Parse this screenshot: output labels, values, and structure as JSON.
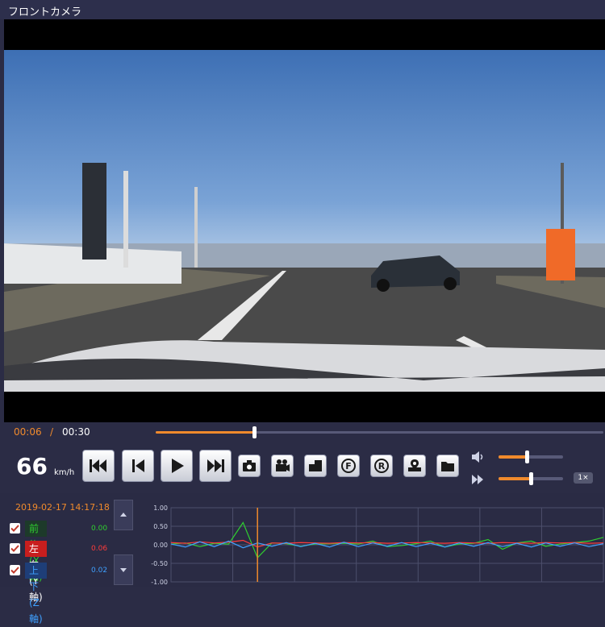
{
  "window": {
    "title": "フロントカメラ"
  },
  "player": {
    "current_time": "00:06",
    "separator": "/",
    "total_time": "00:30",
    "progress": 0.22
  },
  "speedometer": {
    "value": "66",
    "unit": "km/h"
  },
  "toolbar": {
    "buttons": [
      {
        "name": "skip-to-start-button",
        "icon": "skip-start-icon"
      },
      {
        "name": "previous-frame-button",
        "icon": "step-back-icon"
      },
      {
        "name": "play-button",
        "icon": "play-icon"
      },
      {
        "name": "skip-to-end-button",
        "icon": "skip-end-icon"
      },
      {
        "name": "snapshot-button",
        "icon": "camera-icon"
      },
      {
        "name": "video-clip-button",
        "icon": "video-camera-icon"
      },
      {
        "name": "open-file-button",
        "icon": "open-folder-icon"
      },
      {
        "name": "front-camera-button",
        "icon": "front-f-icon"
      },
      {
        "name": "rear-camera-button",
        "icon": "rear-r-icon"
      },
      {
        "name": "map-button",
        "icon": "map-pin-icon"
      },
      {
        "name": "folder-button",
        "icon": "folder-icon"
      }
    ]
  },
  "volume": {
    "level": 0.44
  },
  "playback_speed": {
    "level": 0.5,
    "label": "1×"
  },
  "gsensor": {
    "timestamp": "2019-02-17 14:17:18",
    "axes": [
      {
        "label": "前後(X軸)",
        "value": "0.00",
        "color": "#2fd02f",
        "bg": "#1d3a2a",
        "checked": true
      },
      {
        "label": "左右(Y軸)",
        "value": "0.06",
        "color": "#ff3b3b",
        "bg": "#c81e1e",
        "checked": true
      },
      {
        "label": "上下(Z軸)",
        "value": "0.02",
        "color": "#3fa0ff",
        "bg": "#1e3e78",
        "checked": true
      }
    ]
  },
  "chart_data": {
    "type": "line",
    "yticks": [
      "1.00",
      "0.50",
      "0.00",
      "-0.50",
      "-1.00"
    ],
    "ylim": [
      -1.0,
      1.0
    ],
    "x": [
      0,
      1,
      2,
      3,
      4,
      5,
      6,
      7,
      8,
      9,
      10,
      11,
      12,
      13,
      14,
      15,
      16,
      17,
      18,
      19,
      20,
      21,
      22,
      23,
      24,
      25,
      26,
      27,
      28,
      29,
      30
    ],
    "cursor_x": 6,
    "series": [
      {
        "color": "#2fd02f",
        "values": [
          0.02,
          0.05,
          -0.05,
          0.04,
          0.02,
          0.6,
          -0.35,
          0.05,
          0.03,
          -0.04,
          0.02,
          0.03,
          0.04,
          0.02,
          0.1,
          -0.05,
          -0.02,
          0.03,
          0.1,
          -0.06,
          0.02,
          0.04,
          0.14,
          -0.12,
          0.05,
          0.1,
          -0.04,
          0.02,
          0.06,
          0.1,
          0.2
        ]
      },
      {
        "color": "#ff3b3b",
        "values": [
          0.06,
          0.04,
          0.08,
          0.05,
          0.07,
          0.12,
          -0.06,
          0.05,
          0.04,
          0.06,
          0.05,
          0.04,
          0.06,
          0.05,
          0.06,
          0.04,
          0.05,
          0.06,
          0.05,
          0.04,
          0.06,
          0.05,
          0.04,
          0.06,
          0.05,
          0.04,
          0.06,
          0.05,
          0.06,
          0.04,
          0.05
        ]
      },
      {
        "color": "#3fa0ff",
        "values": [
          0.02,
          -0.06,
          0.08,
          -0.05,
          0.1,
          -0.08,
          0.05,
          -0.04,
          0.06,
          -0.05,
          0.04,
          -0.06,
          0.07,
          -0.05,
          0.05,
          -0.04,
          0.06,
          -0.05,
          0.04,
          -0.06,
          0.05,
          -0.04,
          0.06,
          -0.05,
          0.04,
          -0.06,
          0.05,
          -0.04,
          0.05,
          -0.05,
          0.03
        ]
      }
    ]
  }
}
